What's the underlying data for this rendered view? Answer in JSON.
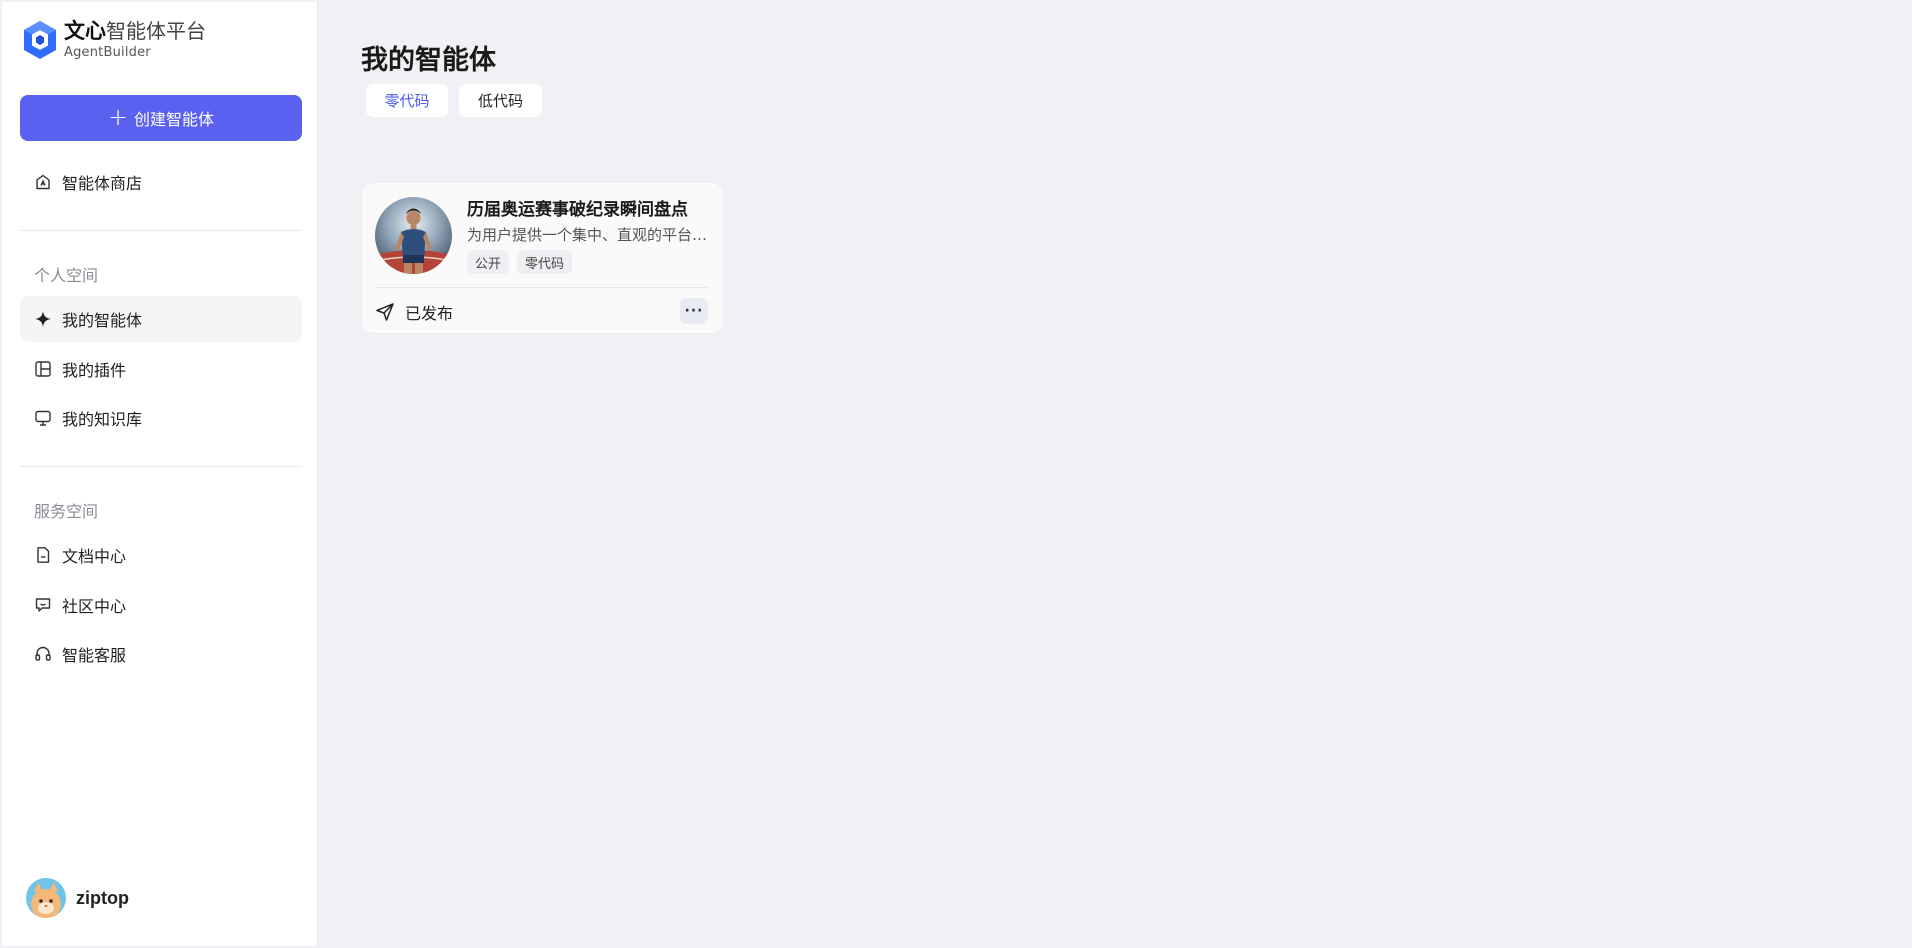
{
  "sidebar": {
    "logo": {
      "title_bold": "文心",
      "title_rest": "智能体平台",
      "subtitle": "AgentBuilder"
    },
    "create_button": "创建智能体",
    "store": "智能体商店",
    "personal_section": "个人空间",
    "personal_items": [
      "我的智能体",
      "我的插件",
      "我的知识库"
    ],
    "service_section": "服务空间",
    "service_items": [
      "文档中心",
      "社区中心",
      "智能客服"
    ],
    "user": {
      "name": "ziptop"
    }
  },
  "main": {
    "title": "我的智能体",
    "tabs": [
      "零代码",
      "低代码"
    ],
    "active_tab": "零代码",
    "agents": [
      {
        "name": "历届奥运赛事破纪录瞬间盘点",
        "description": "为用户提供一个集中、直观的平台，回顾历届奥运会上的破纪录瞬间",
        "tags": [
          "公开",
          "零代码"
        ],
        "status": "已发布",
        "more_label": "···"
      }
    ]
  },
  "colors": {
    "accent": "#5a61f0",
    "active_tab_text": "#4f5aed",
    "background": "#f0f1f5"
  }
}
